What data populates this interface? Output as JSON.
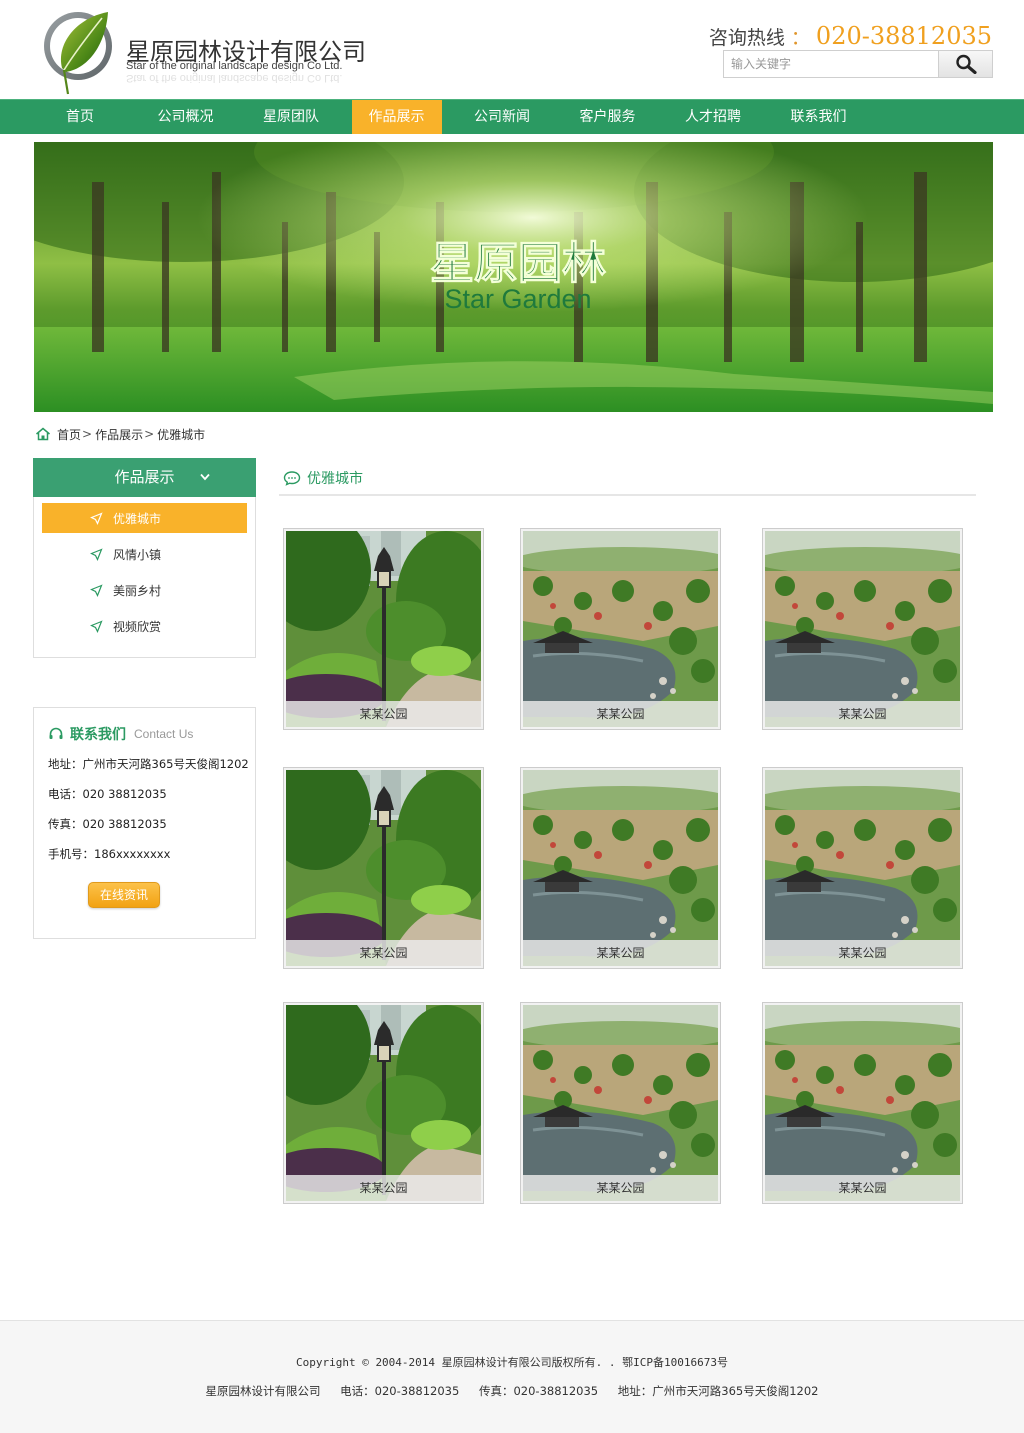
{
  "header": {
    "company_name": "星原园林设计有限公司",
    "company_name_en": "Star of the original landscape design Co Ltd.",
    "hotline_label": "咨询热线",
    "hotline_sep": "：",
    "hotline_number": "020-38812035",
    "search_placeholder": "输入关键字"
  },
  "nav": {
    "items": [
      "首页",
      "公司概况",
      "星原团队",
      "作品展示",
      "公司新闻",
      "客户服务",
      "人才招聘",
      "联系我们"
    ],
    "active_index": 3
  },
  "banner": {
    "title_cn": "星原园林",
    "title_en": "Star  Garden"
  },
  "breadcrumb": {
    "items": [
      "首页",
      "作品展示",
      "优雅城市"
    ],
    "separator": ">"
  },
  "sidebar": {
    "title": "作品展示",
    "items": [
      "优雅城市",
      "风情小镇",
      "美丽乡村",
      "视频欣赏"
    ],
    "active_index": 0
  },
  "contact": {
    "title": "联系我们",
    "title_en": "Contact Us",
    "address": "地址：广州市天河路365号天俊阁1202",
    "phone": "电话：020  38812035",
    "fax": "传真：020  38812035",
    "mobile": "手机号：186xxxxxxxx",
    "online_button": "在线资讯"
  },
  "main": {
    "title": "优雅城市",
    "cards": [
      {
        "caption": "某某公园",
        "image": "park-lamp"
      },
      {
        "caption": "某某公园",
        "image": "park-pond"
      },
      {
        "caption": "某某公园",
        "image": "park-pond"
      },
      {
        "caption": "某某公园",
        "image": "park-lamp"
      },
      {
        "caption": "某某公园",
        "image": "park-pond"
      },
      {
        "caption": "某某公园",
        "image": "park-pond"
      },
      {
        "caption": "某某公园",
        "image": "park-lamp"
      },
      {
        "caption": "某某公园",
        "image": "park-pond"
      },
      {
        "caption": "某某公园",
        "image": "park-pond"
      }
    ]
  },
  "footer": {
    "copyright": "Copyright © 2004-2014  星原园林设计有限公司版权所有. .   鄂ICP备10016673号",
    "company": "星原园林设计有限公司",
    "phone": "电话：020-38812035",
    "fax": "传真：020-38812035",
    "address": "地址：广州市天河路365号天俊阁1202"
  },
  "colors": {
    "brand_green": "#2b9a62",
    "accent_orange": "#f9b22a",
    "hotline_orange": "#f0a01f"
  }
}
